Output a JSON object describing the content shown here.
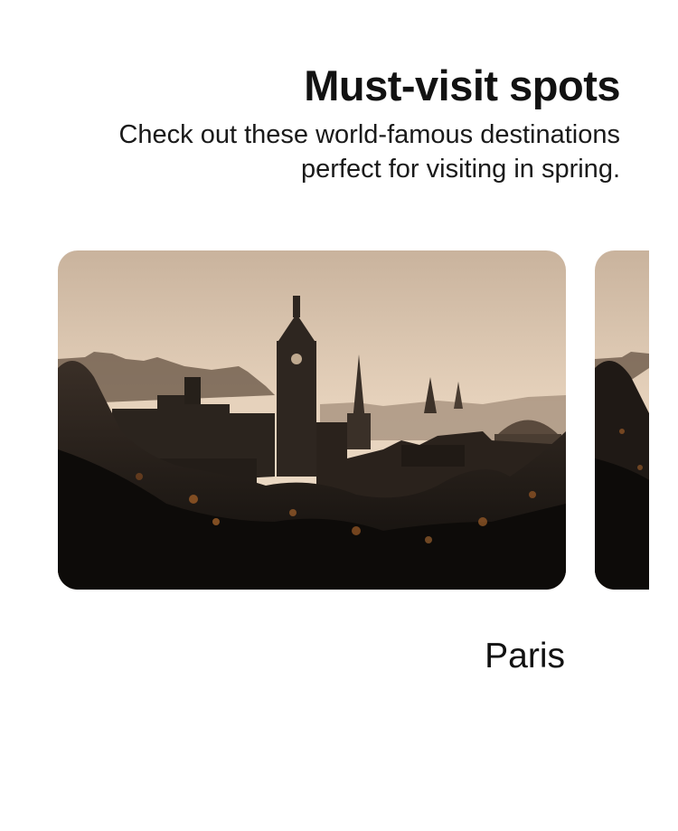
{
  "header": {
    "title": "Must-visit spots",
    "subtitle": "Check out these world-famous destinations perfect for visiting in spring."
  },
  "carousel": {
    "cards": [
      {
        "caption": "Paris",
        "image": "city-skyline-at-sunset-photo"
      },
      {
        "caption": "",
        "image": "city-skyline-at-sunset-photo"
      }
    ]
  },
  "colors": {
    "sky_top": "#cdb59c",
    "sky_bottom": "#ead6bf",
    "silhouette": "#2b2520",
    "foliage": "#0f0d0b",
    "highlight": "#a6602a"
  }
}
